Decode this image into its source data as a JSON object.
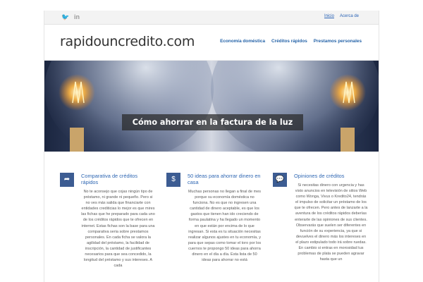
{
  "topbar": {
    "social": [
      {
        "icon": "twitter-icon",
        "glyph": "🐦"
      },
      {
        "icon": "linkedin-icon",
        "glyph": "in"
      }
    ],
    "nav": [
      {
        "label": "Inicio",
        "active": true
      },
      {
        "label": "Acerca de",
        "active": false
      }
    ]
  },
  "header": {
    "logo": "rapidouncredito.com",
    "nav": [
      "Economía doméstica",
      "Créditos rápidos",
      "Prestamos personales"
    ]
  },
  "hero": {
    "caption": "Cómo ahorrar en la factura de la luz"
  },
  "columns": [
    {
      "icon": "share-arrow-icon",
      "glyph": "➦",
      "title": "Comparativa de créditos rápidos",
      "body": "No te aconsejo que cojas ningún tipo de préstamo, ni grande ni pequeño. Pero si no ves más salida que financiarte con entidades crediticias lo mejor es que mires las fichas que he preparado para cada uno de los créditos rápidos que te ofrecen en internet. Estas fichas son la base para una comparativa seria sobre prestamos personales. En cada ficha se valora la agilidad del préstamo, la facilidad de inscripción, la cantidad de justificantes necesarios para que sea concedido, la longitud del préstamo y sus intereses. A cada"
    },
    {
      "icon": "money-icon",
      "glyph": "$",
      "title": "50 ideas para ahorrar dinero en casa",
      "body": "Muchas personas no llegan a final de mes porque su economía doméstica no funciona. No es que no ingresen una cantidad de dinero aceptable, es que los gastos que tienen han ido creciendo de forma paulatina y ha llegado un momento en que están por encima de lo que ingresan. Si esta es tu situación necesitas realizar algunos ajustes en tu economía, y para que sepas como tomar el toro por los cuernos te propongo 50 ideas para ahorra dinero en el día a día. Esta lista de 50 ideas para ahorrar no está"
    },
    {
      "icon": "comments-icon",
      "glyph": "💬",
      "title": "Opiniones de créditos",
      "body": "Si necesitas dinero con urgencia y has visto anuncios en televisión de sitios Web como Wonga, Vivus o Kredito24, tendrás el impulso de solicitar un préstamo de los que te ofrecen. Pero antes de lanzarte a la aventura de los créditos rápidos deberías enterarte de las opiniones de sus clientes. Observarás que suelen ser diferentes en función de su experiencia, ya que si devuelves el dinero más los intereses en el plazo estipulado todo irá sobre ruedas. En cambio si entras en morosidad tus problemas de plata se pueden agravar hasta que un"
    }
  ]
}
